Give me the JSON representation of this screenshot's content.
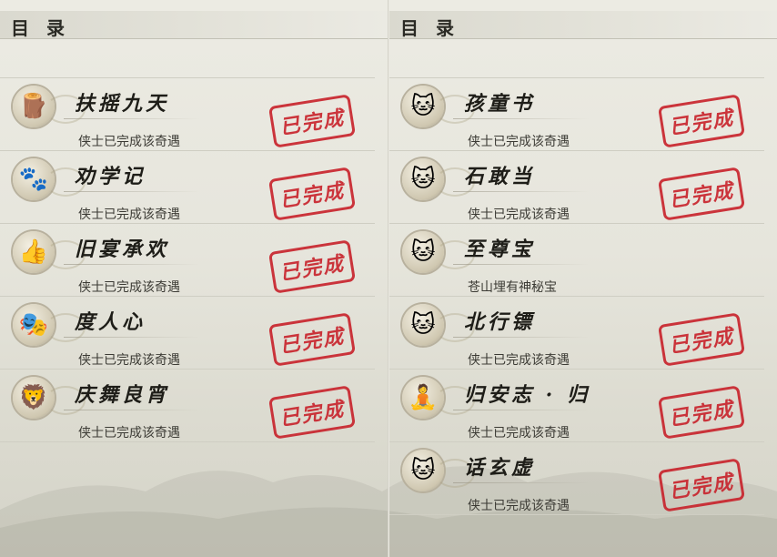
{
  "header": {
    "title": "目 录"
  },
  "left": {
    "items": [
      {
        "name": "扶摇九天",
        "status": "侠士已完成该奇遇",
        "stamp": "已完成",
        "icon": "wooden-dummy-icon",
        "completed": true
      },
      {
        "name": "劝学记",
        "status": "侠士已完成该奇遇",
        "stamp": "已完成",
        "icon": "paw-print-icon",
        "completed": true
      },
      {
        "name": "旧宴承欢",
        "status": "侠士已完成该奇遇",
        "stamp": "已完成",
        "icon": "thumbs-up-icon",
        "completed": true
      },
      {
        "name": "度人心",
        "status": "侠士已完成该奇遇",
        "stamp": "已完成",
        "icon": "mask-icon",
        "completed": true
      },
      {
        "name": "庆舞良宵",
        "status": "侠士已完成该奇遇",
        "stamp": "已完成",
        "icon": "lion-dance-icon",
        "completed": true
      }
    ]
  },
  "right": {
    "items": [
      {
        "name": "孩童书",
        "status": "侠士已完成该奇遇",
        "stamp": "已完成",
        "icon": "cat-icon",
        "completed": true
      },
      {
        "name": "石敢当",
        "status": "侠士已完成该奇遇",
        "stamp": "已完成",
        "icon": "cat-icon",
        "completed": true
      },
      {
        "name": "至尊宝",
        "status": "苍山埋有神秘宝",
        "stamp": "",
        "icon": "cat-icon",
        "completed": false
      },
      {
        "name": "北行镖",
        "status": "侠士已完成该奇遇",
        "stamp": "已完成",
        "icon": "cat-icon",
        "completed": true
      },
      {
        "name": "归安志 · 归",
        "status": "侠士已完成该奇遇",
        "stamp": "已完成",
        "icon": "golden-buddha-icon",
        "completed": true
      },
      {
        "name": "话玄虚",
        "status": "侠士已完成该奇遇",
        "stamp": "已完成",
        "icon": "cat-icon",
        "completed": true
      }
    ]
  },
  "colors": {
    "stamp": "#c8212a",
    "text": "#1e1d18",
    "background": "#e8e7df"
  }
}
